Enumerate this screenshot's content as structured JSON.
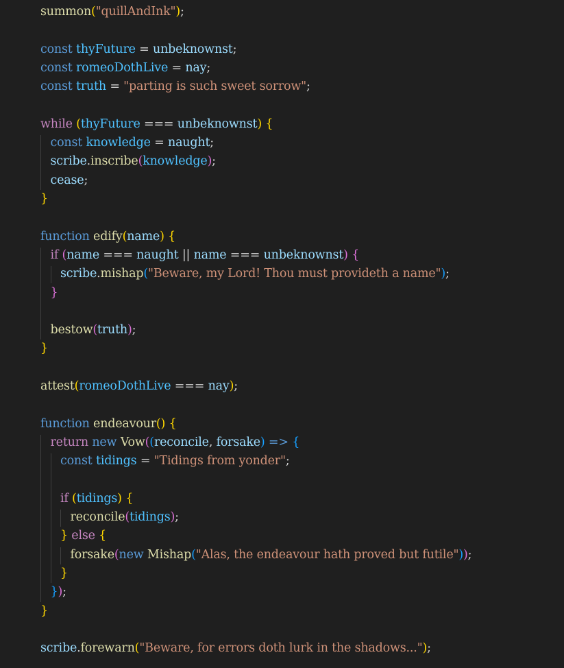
{
  "editor": {
    "background": "#1f1f1f",
    "colors": {
      "keyword": "#5a9bd8",
      "control": "#c586c0",
      "function": "#dcdcaa",
      "variable": "#9cdcfe",
      "constant": "#4fc1ff",
      "string": "#ce9178",
      "operator": "#d4d4d4",
      "bracket_1": "#ffd700",
      "bracket_2": "#da70d6",
      "bracket_3": "#179fff"
    },
    "lines": [
      {
        "t": [
          [
            "fn",
            "summon"
          ],
          [
            "b1",
            "("
          ],
          [
            "str",
            "\"quillAndInk\""
          ],
          [
            "b1",
            ")"
          ],
          [
            "op",
            ";"
          ]
        ]
      },
      {
        "t": []
      },
      {
        "t": [
          [
            "kw",
            "const "
          ],
          [
            "cn",
            "thyFuture"
          ],
          [
            "op",
            " = "
          ],
          [
            "var",
            "unbeknownst"
          ],
          [
            "op",
            ";"
          ]
        ]
      },
      {
        "t": [
          [
            "kw",
            "const "
          ],
          [
            "cn",
            "romeoDothLive"
          ],
          [
            "op",
            " = "
          ],
          [
            "var",
            "nay"
          ],
          [
            "op",
            ";"
          ]
        ]
      },
      {
        "t": [
          [
            "kw",
            "const "
          ],
          [
            "cn",
            "truth"
          ],
          [
            "op",
            " = "
          ],
          [
            "str",
            "\"parting is such sweet sorrow\""
          ],
          [
            "op",
            ";"
          ]
        ]
      },
      {
        "t": []
      },
      {
        "t": [
          [
            "ctl",
            "while "
          ],
          [
            "b1",
            "("
          ],
          [
            "cn",
            "thyFuture"
          ],
          [
            "op",
            " === "
          ],
          [
            "var",
            "unbeknownst"
          ],
          [
            "b1",
            ")"
          ],
          [
            "op",
            " "
          ],
          [
            "b1",
            "{"
          ]
        ]
      },
      {
        "t": [
          [
            "kw",
            "const "
          ],
          [
            "cn",
            "knowledge"
          ],
          [
            "op",
            " = "
          ],
          [
            "var",
            "naught"
          ],
          [
            "op",
            ";"
          ]
        ]
      },
      {
        "t": [
          [
            "var",
            "scribe"
          ],
          [
            "op",
            "."
          ],
          [
            "fn",
            "inscribe"
          ],
          [
            "b2",
            "("
          ],
          [
            "cn",
            "knowledge"
          ],
          [
            "b2",
            ")"
          ],
          [
            "op",
            ";"
          ]
        ]
      },
      {
        "t": [
          [
            "var",
            "cease"
          ],
          [
            "op",
            ";"
          ]
        ]
      },
      {
        "t": [
          [
            "b1",
            "}"
          ]
        ]
      },
      {
        "t": []
      },
      {
        "t": [
          [
            "kw",
            "function "
          ],
          [
            "fn",
            "edify"
          ],
          [
            "b1",
            "("
          ],
          [
            "var",
            "name"
          ],
          [
            "b1",
            ")"
          ],
          [
            "op",
            " "
          ],
          [
            "b1",
            "{"
          ]
        ]
      },
      {
        "t": [
          [
            "ctl",
            "if "
          ],
          [
            "b2",
            "("
          ],
          [
            "var",
            "name"
          ],
          [
            "op",
            " === "
          ],
          [
            "var",
            "naught"
          ],
          [
            "op",
            " || "
          ],
          [
            "var",
            "name"
          ],
          [
            "op",
            " === "
          ],
          [
            "var",
            "unbeknownst"
          ],
          [
            "b2",
            ")"
          ],
          [
            "op",
            " "
          ],
          [
            "b2",
            "{"
          ]
        ]
      },
      {
        "t": [
          [
            "var",
            "scribe"
          ],
          [
            "op",
            "."
          ],
          [
            "fn",
            "mishap"
          ],
          [
            "b3",
            "("
          ],
          [
            "str",
            "\"Beware, my Lord! Thou must provideth a name\""
          ],
          [
            "b3",
            ")"
          ],
          [
            "op",
            ";"
          ]
        ]
      },
      {
        "t": [
          [
            "b2",
            "}"
          ]
        ]
      },
      {
        "t": []
      },
      {
        "t": [
          [
            "fn",
            "bestow"
          ],
          [
            "b2",
            "("
          ],
          [
            "var",
            "truth"
          ],
          [
            "b2",
            ")"
          ],
          [
            "op",
            ";"
          ]
        ]
      },
      {
        "t": [
          [
            "b1",
            "}"
          ]
        ]
      },
      {
        "t": []
      },
      {
        "t": [
          [
            "fn",
            "attest"
          ],
          [
            "b1",
            "("
          ],
          [
            "cn",
            "romeoDothLive"
          ],
          [
            "op",
            " === "
          ],
          [
            "var",
            "nay"
          ],
          [
            "b1",
            ")"
          ],
          [
            "op",
            ";"
          ]
        ]
      },
      {
        "t": []
      },
      {
        "t": [
          [
            "kw",
            "function "
          ],
          [
            "fn",
            "endeavour"
          ],
          [
            "b1",
            "()"
          ],
          [
            "op",
            " "
          ],
          [
            "b1",
            "{"
          ]
        ]
      },
      {
        "t": [
          [
            "ctl",
            "return "
          ],
          [
            "kw",
            "new "
          ],
          [
            "fn",
            "Vow"
          ],
          [
            "b2",
            "("
          ],
          [
            "b3",
            "("
          ],
          [
            "var",
            "reconcile"
          ],
          [
            "op",
            ", "
          ],
          [
            "var",
            "forsake"
          ],
          [
            "b3",
            ")"
          ],
          [
            "kw",
            " => "
          ],
          [
            "b3",
            "{"
          ]
        ]
      },
      {
        "t": [
          [
            "kw",
            "const "
          ],
          [
            "cn",
            "tidings"
          ],
          [
            "op",
            " = "
          ],
          [
            "str",
            "\"Tidings from yonder\""
          ],
          [
            "op",
            ";"
          ]
        ]
      },
      {
        "t": []
      },
      {
        "t": [
          [
            "ctl",
            "if "
          ],
          [
            "b1",
            "("
          ],
          [
            "cn",
            "tidings"
          ],
          [
            "b1",
            ")"
          ],
          [
            "op",
            " "
          ],
          [
            "b1",
            "{"
          ]
        ]
      },
      {
        "t": [
          [
            "fn",
            "reconcile"
          ],
          [
            "b2",
            "("
          ],
          [
            "cn",
            "tidings"
          ],
          [
            "b2",
            ")"
          ],
          [
            "op",
            ";"
          ]
        ]
      },
      {
        "t": [
          [
            "b1",
            "}"
          ],
          [
            "ctl",
            " else "
          ],
          [
            "b1",
            "{"
          ]
        ]
      },
      {
        "t": [
          [
            "fn",
            "forsake"
          ],
          [
            "b2",
            "("
          ],
          [
            "kw",
            "new "
          ],
          [
            "fn",
            "Mishap"
          ],
          [
            "b3",
            "("
          ],
          [
            "str",
            "\"Alas, the endeavour hath proved but futile\""
          ],
          [
            "b3",
            ")"
          ],
          [
            "b2",
            ")"
          ],
          [
            "op",
            ";"
          ]
        ]
      },
      {
        "t": [
          [
            "b1",
            "}"
          ]
        ]
      },
      {
        "t": [
          [
            "b3",
            "}"
          ],
          [
            "b2",
            ")"
          ],
          [
            "op",
            ";"
          ]
        ]
      },
      {
        "t": [
          [
            "b1",
            "}"
          ]
        ]
      },
      {
        "t": []
      },
      {
        "t": [
          [
            "var",
            "scribe"
          ],
          [
            "op",
            "."
          ],
          [
            "fn",
            "forewarn"
          ],
          [
            "b1",
            "("
          ],
          [
            "str",
            "\"Beware, for errors doth lurk in the shadows...\""
          ],
          [
            "b1",
            ")"
          ],
          [
            "op",
            ";"
          ]
        ]
      }
    ]
  }
}
